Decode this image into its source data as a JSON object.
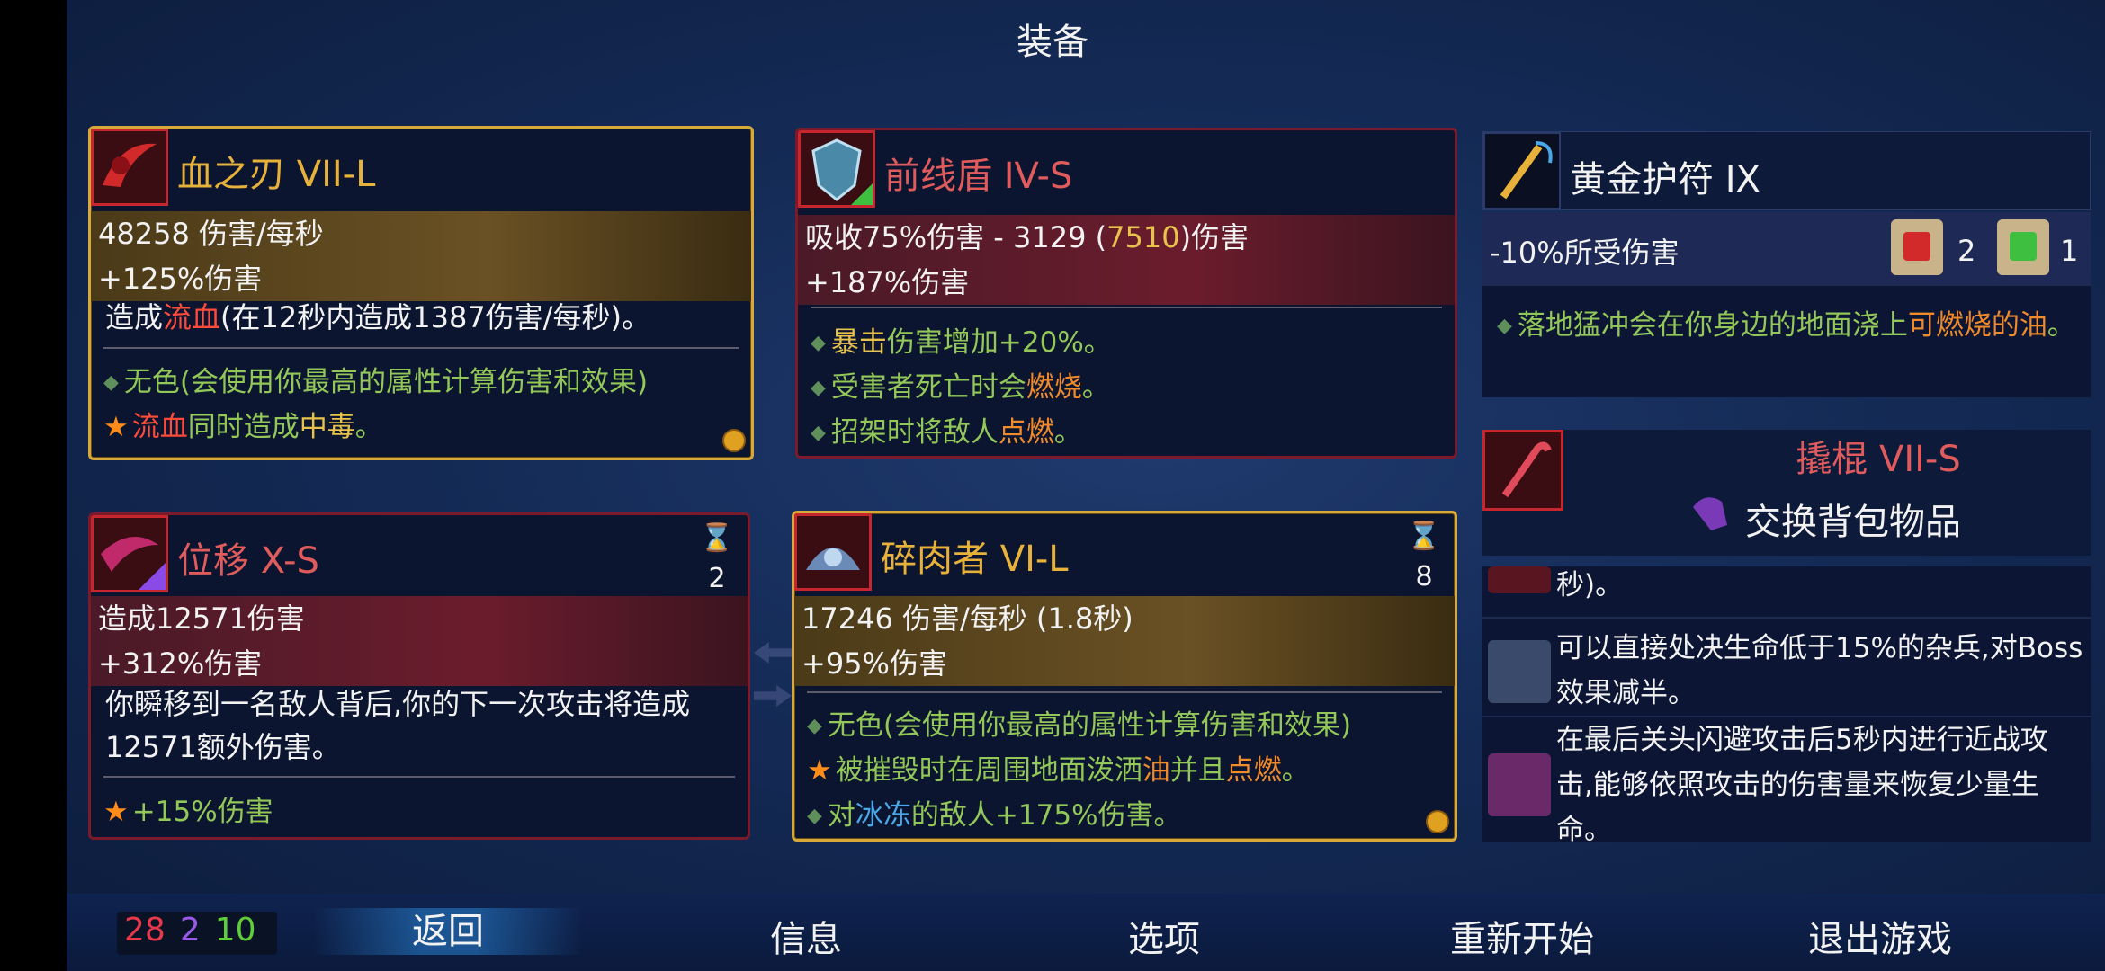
{
  "title": "装备",
  "weapons": [
    {
      "name": "血之刃 VII-L",
      "stat1": "48258 伤害/每秒",
      "stat2": "+125%伤害",
      "desc_pre": "造成",
      "desc_key": "流血",
      "desc_post": "(在12秒内造成1387伤害/每秒)。",
      "aff1": "无色(会使用你最高的属性计算伤害和效果)",
      "aff2_key": "流血",
      "aff2_mid": "同时造成",
      "aff2_key2": "中毒",
      "aff2_end": "。"
    },
    {
      "name": "前线盾 IV-S",
      "stat1_pre": "吸收75%伤害 - 3129 (",
      "stat1_key": "7510",
      "stat1_post": ")伤害",
      "stat2": "+187%伤害",
      "aff1_key": "暴击",
      "aff1_post": "伤害增加+20%。",
      "aff2_pre": "受害者死亡时会",
      "aff2_key": "燃烧",
      "aff2_end": "。",
      "aff3_pre": "招架时将敌人",
      "aff3_key": "点燃",
      "aff3_end": "。"
    }
  ],
  "skills": [
    {
      "name": "位移 X-S",
      "cooldown": "2",
      "stat1": "造成12571伤害",
      "stat2": "+312%伤害",
      "desc": "你瞬移到一名敌人背后,你的下一次攻击将造成12571额外伤害。",
      "aff1": "+15%伤害"
    },
    {
      "name": "碎肉者 VI-L",
      "cooldown": "8",
      "stat1": "17246 伤害/每秒 (1.8秒)",
      "stat2": "+95%伤害",
      "aff1": "无色(会使用你最高的属性计算伤害和效果)",
      "aff2_pre": "被摧毁时在周围地面泼洒",
      "aff2_key": "油",
      "aff2_mid": "并且",
      "aff2_key2": "点燃",
      "aff2_end": "。",
      "aff3_pre": "对",
      "aff3_key": "冰冻",
      "aff3_post": "的敌人+175%伤害。"
    }
  ],
  "amulet": {
    "name": "黄金护符 IX",
    "stat": "-10%所受伤害",
    "scroll_red_count": "2",
    "scroll_green_count": "1",
    "desc_pre": "落地猛冲会在你身边的地面浇上",
    "desc_key": "可燃烧的油",
    "desc_end": "。"
  },
  "backpack": {
    "name": "撬棍 VII-S",
    "swap_label": "交换背包物品"
  },
  "mutations": [
    {
      "text": "秒)。"
    },
    {
      "text": "可以直接处决生命低于15%的杂兵,对Boss效果减半。"
    },
    {
      "text": "在最后关头闪避攻击后5秒内进行近战攻击,能够依照攻击的伤害量来恢复少量生命。"
    }
  ],
  "scrolls": {
    "brutality": "28",
    "tactics": "2",
    "survival": "10"
  },
  "colors": {
    "brutality": "#e8384a",
    "tactics": "#9a5ae8",
    "survival": "#5fce3a"
  },
  "nav": {
    "back": "返回",
    "info": "信息",
    "options": "选项",
    "restart": "重新开始",
    "quit": "退出游戏"
  }
}
